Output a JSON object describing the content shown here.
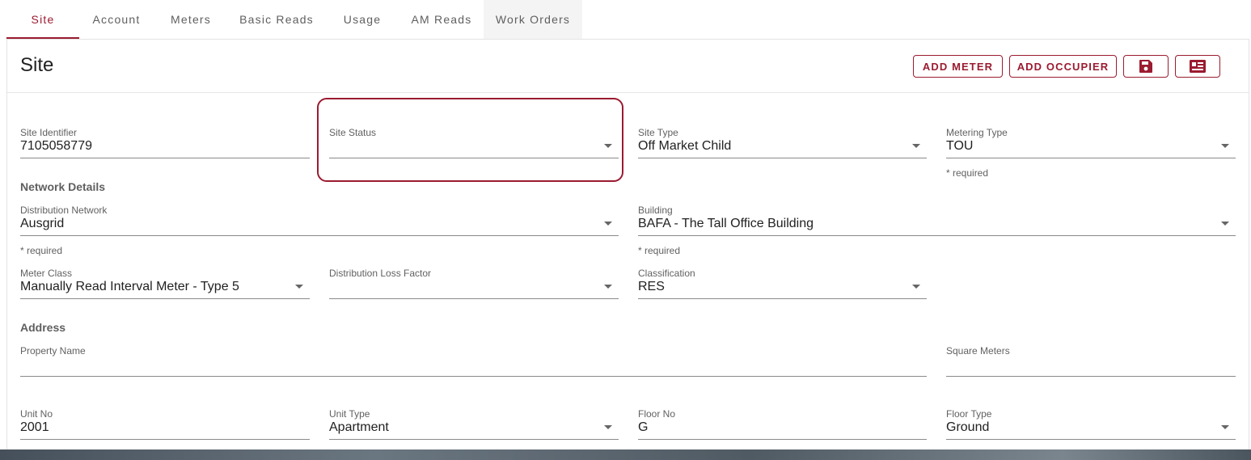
{
  "tabs": [
    "Site",
    "Account",
    "Meters",
    "Basic Reads",
    "Usage",
    "AM Reads",
    "Work Orders"
  ],
  "card": {
    "title": "Site"
  },
  "toolbar": {
    "add_meter": "ADD METER",
    "add_occupier": "ADD OCCUPIER",
    "save_icon": "save-icon",
    "form_icon": "form-view-icon"
  },
  "fields": {
    "site_identifier": {
      "label": "Site Identifier",
      "value": "7105058779"
    },
    "site_status": {
      "label": "Site Status",
      "value": ""
    },
    "site_type": {
      "label": "Site Type",
      "value": "Off Market Child"
    },
    "metering_type": {
      "label": "Metering Type",
      "value": "TOU",
      "hint": "* required"
    },
    "distribution_network": {
      "label": "Distribution Network",
      "value": "Ausgrid",
      "hint": "* required"
    },
    "building": {
      "label": "Building",
      "value": "BAFA - The Tall Office Building",
      "hint": "* required"
    },
    "meter_class": {
      "label": "Meter Class",
      "value": "Manually Read Interval Meter - Type 5"
    },
    "distribution_loss_factor": {
      "label": "Distribution Loss Factor",
      "value": ""
    },
    "classification": {
      "label": "Classification",
      "value": "RES"
    },
    "property_name": {
      "label": "Property Name",
      "value": ""
    },
    "square_meters": {
      "label": "Square Meters",
      "value": ""
    },
    "unit_no": {
      "label": "Unit No",
      "value": "2001"
    },
    "unit_type": {
      "label": "Unit Type",
      "value": "Apartment"
    },
    "floor_no": {
      "label": "Floor No",
      "value": "G"
    },
    "floor_type": {
      "label": "Floor Type",
      "value": "Ground"
    }
  },
  "sections": {
    "network": "Network Details",
    "address": "Address"
  },
  "colors": {
    "accent": "#9b1b30"
  }
}
